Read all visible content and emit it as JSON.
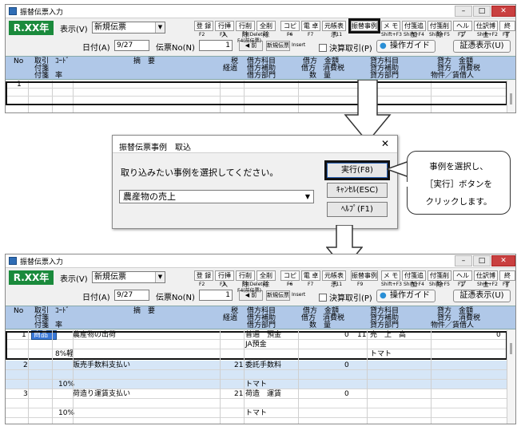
{
  "window": {
    "title": "振替伝票入力",
    "era": "R.XX年",
    "display_label": "表示(V)",
    "display_value": "新規伝票",
    "date_label": "日付(A)",
    "date_value": "9/27",
    "denpyo_label": "伝票No(N)",
    "denpyo_value": "1",
    "prev_btn": "F4(前伝票)",
    "insert_label": "Insert",
    "new_btn": "新規伝票",
    "kessan_label": "決算取引(P)",
    "guide_btn": "操作ガイド",
    "shoko_btn": "証憑表示(U)",
    "fkeys": [
      {
        "label": "登 録",
        "key": "F2"
      },
      {
        "label": "行挿入",
        "key": "F3"
      },
      {
        "label": "行削除",
        "key": "F4(Delete)"
      },
      {
        "label": "全削除",
        "key": "F6"
      },
      {
        "label": "コピー",
        "key": "F7"
      },
      {
        "label": "電 卓",
        "key": "F8"
      },
      {
        "label": "元帳表示",
        "key": "F11"
      },
      {
        "label": "振替事例",
        "key": "F9"
      },
      {
        "label": "メ モ",
        "key": "Shift+F3"
      },
      {
        "label": "付箋追加",
        "key": "Shift+F4"
      },
      {
        "label": "付箋削除",
        "key": "Shift+F5"
      },
      {
        "label": "ヘルプ",
        "key": "F1"
      },
      {
        "label": "仕訳博士",
        "key": "Shift+F2"
      },
      {
        "label": "終 了",
        "key": "F8"
      }
    ],
    "header": {
      "no": "No",
      "torihiki1": "取引",
      "torihiki2": "付箋",
      "torihiki3": "付箋",
      "code": "ｺｰﾄﾞ",
      "rate": "率",
      "tekiyo": "摘　要",
      "zei1": "税",
      "zei2": "経過",
      "kari1": "借方科目",
      "kari2": "借方補助",
      "kari3": "借方部門",
      "kari_amt1": "借方　金額",
      "kari_amt2": "借方　消費税",
      "kari_amt3": "数　量",
      "kashi1": "貸方科目",
      "kashi2": "貸方補助",
      "kashi3": "貸方部門",
      "kashi_amt1": "貸方　金額",
      "kashi_amt2": "貸方　消費税",
      "kashi_amt3": "物件／賃借人"
    }
  },
  "top_grid": {
    "row_no": "1"
  },
  "bottom_grid": {
    "rows": [
      {
        "no": "1",
        "code": "商品",
        "tekiyo": "農産物の出荷",
        "kari": "普通　預金",
        "kari_sub": "JA預金",
        "kari_amt": "0",
        "kashi_code": "11",
        "kashi": "売　上　高",
        "kashi_amt": "0",
        "rate": "8%軽",
        "kashi_sub": "トマト"
      },
      {
        "no": "2",
        "tekiyo": "販売手数料支払い",
        "zei": "21",
        "kari": "委託手数料",
        "kari_amt": "0",
        "rate": "10%",
        "kari_sub": "トマト"
      },
      {
        "no": "3",
        "tekiyo": "荷造り運賃支払い",
        "zei": "21",
        "kari": "荷造　運賃",
        "kari_amt": "0",
        "rate": "10%",
        "kari_sub": "トマト"
      }
    ]
  },
  "dialog": {
    "title": "振替伝票事例　取込",
    "close": "✕",
    "prompt": "取り込みたい事例を選択してください。",
    "selected": "農産物の売上",
    "exec_btn": "実行(F8)",
    "cancel_btn": "ｷｬﾝｾﾙ(ESC)",
    "help_btn": "ﾍﾙﾌﾟ(F1)"
  },
  "callout": {
    "line1": "事例を選択し、",
    "line2": "［実行］ボタンを",
    "line3": "クリックします。"
  }
}
